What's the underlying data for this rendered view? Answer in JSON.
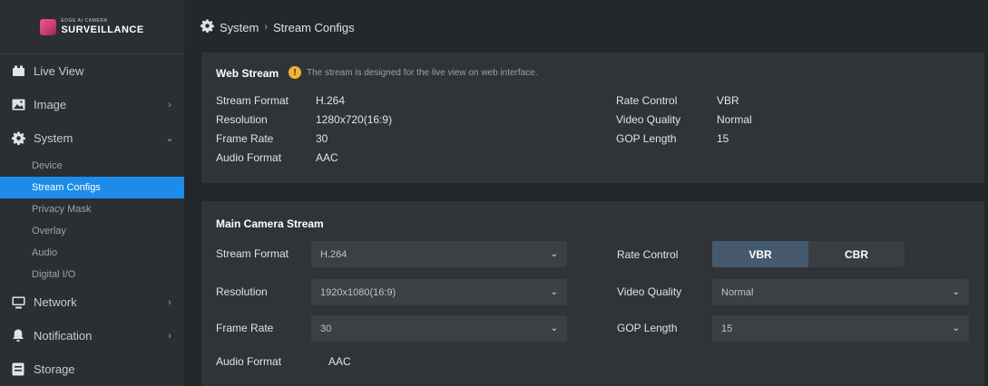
{
  "brand": {
    "small": "EDGE AI CAMERA",
    "big": "SURVEILLANCE"
  },
  "sidebar": {
    "items": [
      {
        "label": "Live View",
        "icon": "video-icon"
      },
      {
        "label": "Image",
        "icon": "image-icon"
      },
      {
        "label": "System",
        "icon": "gear-icon"
      },
      {
        "label": "Network",
        "icon": "monitor-icon"
      },
      {
        "label": "Notification",
        "icon": "bell-icon"
      },
      {
        "label": "Storage",
        "icon": "storage-icon"
      }
    ],
    "system_sub": [
      "Device",
      "Stream Configs",
      "Privacy Mask",
      "Overlay",
      "Audio",
      "Digital I/O"
    ],
    "active_sub": "Stream Configs"
  },
  "breadcrumb": {
    "section": "System",
    "page": "Stream Configs"
  },
  "web_stream": {
    "title": "Web Stream",
    "hint": "The stream is designed for the live view on web interface.",
    "left": [
      {
        "key": "Stream Format",
        "value": "H.264"
      },
      {
        "key": "Resolution",
        "value": "1280x720(16:9)"
      },
      {
        "key": "Frame Rate",
        "value": "30"
      },
      {
        "key": "Audio Format",
        "value": "AAC"
      }
    ],
    "right": [
      {
        "key": "Rate Control",
        "value": "VBR"
      },
      {
        "key": "Video Quality",
        "value": "Normal"
      },
      {
        "key": "GOP Length",
        "value": "15"
      }
    ]
  },
  "main_stream": {
    "title": "Main Camera Stream",
    "stream_format": {
      "label": "Stream Format",
      "value": "H.264"
    },
    "resolution": {
      "label": "Resolution",
      "value": "1920x1080(16:9)"
    },
    "frame_rate": {
      "label": "Frame Rate",
      "value": "30"
    },
    "audio_format": {
      "label": "Audio Format",
      "value": "AAC"
    },
    "rate_control": {
      "label": "Rate Control",
      "options": [
        "VBR",
        "CBR"
      ],
      "selected": "VBR"
    },
    "video_quality": {
      "label": "Video Quality",
      "value": "Normal"
    },
    "gop_length": {
      "label": "GOP Length",
      "value": "15"
    }
  },
  "colors": {
    "accent": "#1d8ce8",
    "sidebar_bg": "#2b2e32",
    "panel_bg": "#303438",
    "hint_icon": "#f2b233"
  }
}
